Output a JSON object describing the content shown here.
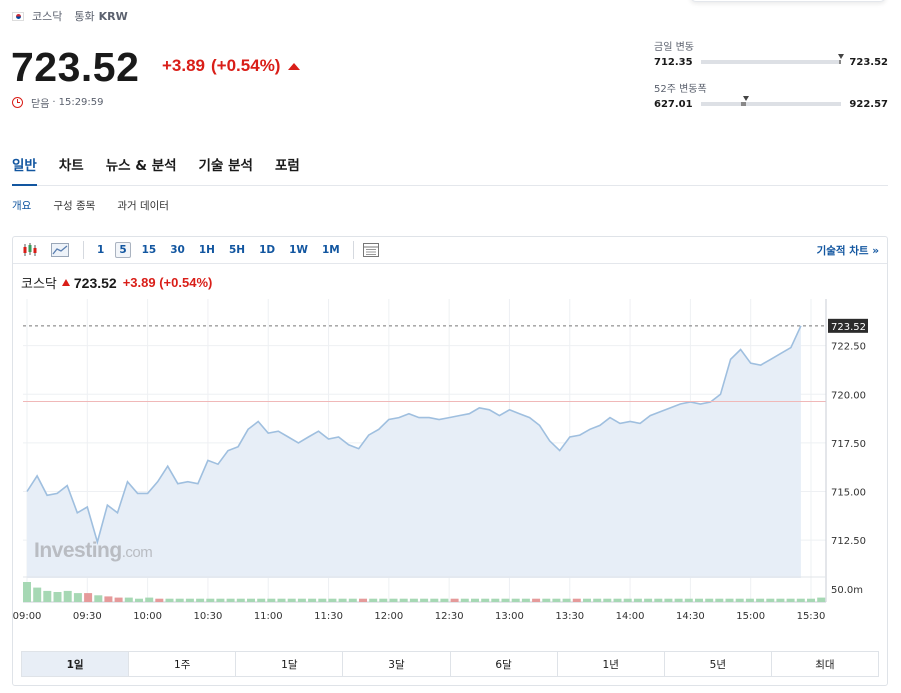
{
  "header": {
    "index_name": "코스닥",
    "currency_label": "통화",
    "currency": "KRW",
    "price": "723.52",
    "change": "+3.89",
    "change_pct": "(+0.54%)",
    "status_label": "닫음",
    "status_time": "15:29:59"
  },
  "ranges": {
    "day_label": "금일 변동",
    "day_low": "712.35",
    "day_high": "723.52",
    "week52_label": "52주 변동폭",
    "week52_low": "627.01",
    "week52_high": "922.57",
    "day_position": 1.0,
    "week52_position": 0.32
  },
  "tabs": [
    "일반",
    "차트",
    "뉴스 & 분석",
    "기술 분석",
    "포럼"
  ],
  "subtabs": [
    "개요",
    "구성 종목",
    "과거 데이터"
  ],
  "toolbar": {
    "timeframes": [
      "1",
      "5",
      "15",
      "30",
      "1H",
      "5H",
      "1D",
      "1W",
      "1M"
    ],
    "active_timeframe": "5",
    "tech_chart_link": "기술적 차트 »"
  },
  "legend": {
    "name": "코스닥",
    "price": "723.52",
    "change": "+3.89 (+0.54%)"
  },
  "watermark": {
    "main": "Investing",
    "suffix": ".com"
  },
  "periods": [
    "1일",
    "1주",
    "1달",
    "3달",
    "6달",
    "1년",
    "5년",
    "최대"
  ],
  "active_period": "1일",
  "colors": {
    "accent": "#1256a0",
    "down_red": "#d91e18",
    "line": "#9fbfdf",
    "area": "#e7eef7",
    "vol_up": "#a6d8b4",
    "vol_down": "#e59a9a"
  },
  "chart_data": {
    "type": "area",
    "x": [
      "09:00",
      "09:05",
      "09:10",
      "09:15",
      "09:20",
      "09:25",
      "09:30",
      "09:35",
      "09:40",
      "09:45",
      "09:50",
      "09:55",
      "10:00",
      "10:05",
      "10:10",
      "10:15",
      "10:20",
      "10:25",
      "10:30",
      "10:35",
      "10:40",
      "10:45",
      "10:50",
      "10:55",
      "11:00",
      "11:05",
      "11:10",
      "11:15",
      "11:20",
      "11:25",
      "11:30",
      "11:35",
      "11:40",
      "11:45",
      "11:50",
      "11:55",
      "12:00",
      "12:05",
      "12:10",
      "12:15",
      "12:20",
      "12:25",
      "12:30",
      "12:35",
      "12:40",
      "12:45",
      "12:50",
      "12:55",
      "13:00",
      "13:05",
      "13:10",
      "13:15",
      "13:20",
      "13:25",
      "13:30",
      "13:35",
      "13:40",
      "13:45",
      "13:50",
      "13:55",
      "14:00",
      "14:05",
      "14:10",
      "14:15",
      "14:20",
      "14:25",
      "14:30",
      "14:35",
      "14:40",
      "14:45",
      "14:50",
      "14:55",
      "15:00",
      "15:05",
      "15:10",
      "15:15",
      "15:20",
      "15:25",
      "15:30"
    ],
    "values": [
      715.0,
      715.8,
      714.8,
      714.9,
      715.3,
      713.9,
      714.2,
      712.4,
      714.3,
      713.9,
      715.5,
      714.9,
      714.9,
      715.5,
      716.3,
      715.4,
      715.5,
      715.4,
      716.6,
      716.4,
      717.1,
      717.3,
      718.2,
      718.6,
      718.0,
      718.1,
      717.8,
      717.5,
      717.8,
      718.1,
      717.7,
      717.8,
      717.4,
      717.2,
      717.9,
      718.2,
      718.7,
      718.8,
      719.0,
      718.8,
      718.8,
      718.7,
      718.8,
      718.9,
      719.0,
      719.3,
      719.2,
      718.9,
      719.2,
      719.0,
      718.8,
      718.4,
      717.6,
      717.1,
      717.8,
      717.9,
      718.2,
      718.4,
      718.8,
      718.5,
      718.6,
      718.5,
      718.9,
      719.1,
      719.3,
      719.5,
      719.6,
      719.5,
      719.6,
      720.0,
      721.8,
      722.3,
      721.6,
      721.5,
      721.8,
      722.1,
      722.4,
      723.52
    ],
    "previous_close": 719.63,
    "volume_up": [
      true,
      true,
      true,
      true,
      true,
      true,
      false,
      true,
      false,
      false,
      true,
      true,
      true,
      false,
      true,
      true,
      true,
      true,
      true,
      true,
      true,
      true,
      true,
      true,
      true,
      true,
      true,
      true,
      true,
      true,
      true,
      true,
      true,
      false,
      true,
      true,
      true,
      true,
      true,
      true,
      true,
      true,
      false,
      true,
      true,
      true,
      true,
      true,
      true,
      true,
      false,
      true,
      true,
      true,
      false,
      true,
      true,
      true,
      true,
      true,
      true,
      true,
      true,
      true,
      true,
      true,
      true,
      true,
      true,
      true,
      true,
      true,
      true,
      true,
      true,
      true,
      true,
      true,
      true
    ],
    "volume_values": [
      18,
      13,
      10,
      9,
      10,
      8,
      8,
      6,
      5,
      4,
      4,
      3,
      4,
      3,
      3,
      3,
      3,
      3,
      3,
      3,
      3,
      3,
      3,
      3,
      3,
      3,
      3,
      3,
      3,
      3,
      3,
      3,
      3,
      3,
      3,
      3,
      3,
      3,
      3,
      3,
      3,
      3,
      3,
      3,
      3,
      3,
      3,
      3,
      3,
      3,
      3,
      3,
      3,
      3,
      3,
      3,
      3,
      3,
      3,
      3,
      3,
      3,
      3,
      3,
      3,
      3,
      3,
      3,
      3,
      3,
      3,
      3,
      3,
      3,
      3,
      3,
      3,
      3,
      4
    ],
    "x_tick_labels": [
      "09:00",
      "09:30",
      "10:00",
      "10:30",
      "11:00",
      "11:30",
      "12:00",
      "12:30",
      "13:00",
      "13:30",
      "14:00",
      "14:30",
      "15:00",
      "15:30"
    ],
    "y_tick_labels": [
      "712.50",
      "715.00",
      "717.50",
      "720.00",
      "722.50"
    ],
    "y_tick_values": [
      712.5,
      715.0,
      717.5,
      720.0,
      722.5
    ],
    "ylim": [
      710.6,
      724.9
    ],
    "volume_tick_label": "50.0m",
    "last_price_label": "723.52",
    "title": "",
    "xlabel": "",
    "ylabel": "",
    "grid": true
  }
}
